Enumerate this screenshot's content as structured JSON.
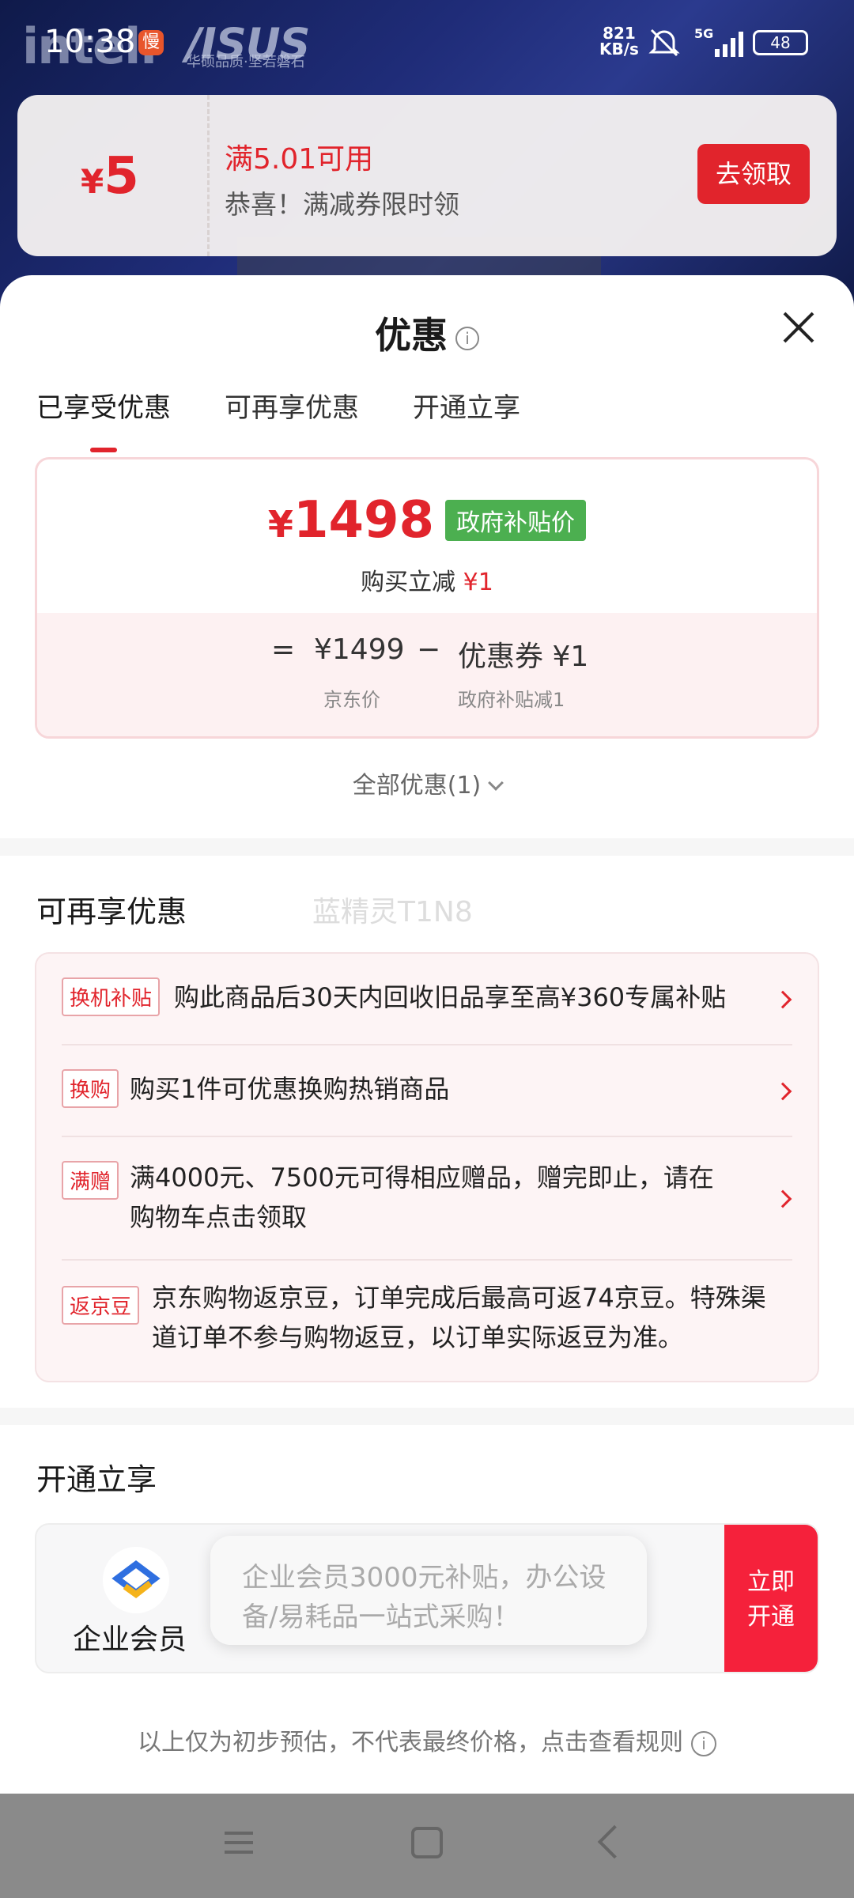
{
  "status_bar": {
    "time": "10:38",
    "slow_badge": "慢",
    "net_speed_value": "821",
    "net_speed_unit": "KB/s",
    "network": "5G",
    "battery": "48"
  },
  "background": {
    "brand_intel": "intel.",
    "brand_asus": "/ISUS",
    "brand_slogan": "华硕品质·坚若磐石"
  },
  "coupon_banner": {
    "currency": "¥",
    "amount": "5",
    "title": "满5.01可用",
    "desc": "恭喜！满减券限时领",
    "button": "去领取"
  },
  "sheet": {
    "title": "优惠",
    "info_glyph": "i",
    "tabs": [
      {
        "label": "已享受优惠",
        "active": true
      },
      {
        "label": "可再享优惠",
        "active": false
      },
      {
        "label": "开通立享",
        "active": false
      }
    ],
    "price": {
      "currency": "¥",
      "value": "1498",
      "gov_tag": "政府补贴价",
      "sub_label": "购买立减",
      "sub_value": "¥1",
      "calc_eq": "=",
      "jd_price": "¥1499",
      "minus": "−",
      "coupon_text": "优惠券 ¥1",
      "jd_label": "京东价",
      "gov_label": "政府补贴减1"
    },
    "all_offers": "全部优惠(1)",
    "more_section": {
      "title": "可再享优惠",
      "watermark": "蓝精灵T1N8",
      "offers": [
        {
          "tag": "换机补贴",
          "text": "购此商品后30天内回收旧品享至高¥360专属补贴"
        },
        {
          "tag": "换购",
          "text": "购买1件可优惠换购热销商品"
        },
        {
          "tag": "满赠",
          "text_line1": "满4000元、7500元可得相应赠品，赠完即止，请在",
          "text_line2": "购物车点击领取"
        },
        {
          "tag": "返京豆",
          "text_line1": "京东购物返京豆，订单完成后最高可返74京豆。特殊渠",
          "text_line2": "道订单不参与购物返豆，以订单实际返豆为准。"
        }
      ]
    },
    "open_section": {
      "title": "开通立享",
      "member_name": "企业会员",
      "tip_line1": "企业会员3000元补贴，办公设",
      "tip_line2": "备/易耗品一站式采购！",
      "button_line1": "立即",
      "button_line2": "开通"
    },
    "footer_note": "以上仅为初步预估，不代表最终价格，点击查看规则"
  },
  "colors": {
    "accent": "#e1242c",
    "gov_green": "#4caf50",
    "member_btn": "#f5213b"
  },
  "icons": {
    "close": "close-icon",
    "info": "info-icon",
    "chevron_down": "chevron-down-icon",
    "chevron_right": "chevron-right-icon",
    "mute": "bell-off-icon",
    "signal": "signal-icon",
    "battery": "battery-icon",
    "member_logo": "enterprise-logo-icon"
  }
}
